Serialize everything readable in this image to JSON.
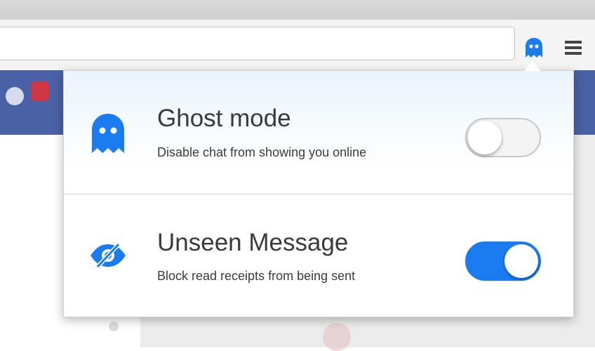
{
  "colors": {
    "accent": "#1a7cf0",
    "toggle_off": "#f3f3f3",
    "facebook_blue": "#4a62a5"
  },
  "toolbar": {
    "extension_icon": "ghost-icon",
    "menu_icon": "hamburger-menu-icon"
  },
  "popup": {
    "settings": [
      {
        "icon": "ghost-icon",
        "title": "Ghost mode",
        "description": "Disable chat from showing you online",
        "enabled": false
      },
      {
        "icon": "eye-slash-icon",
        "title": "Unseen Message",
        "description": "Block read receipts from being sent",
        "enabled": true
      }
    ]
  }
}
